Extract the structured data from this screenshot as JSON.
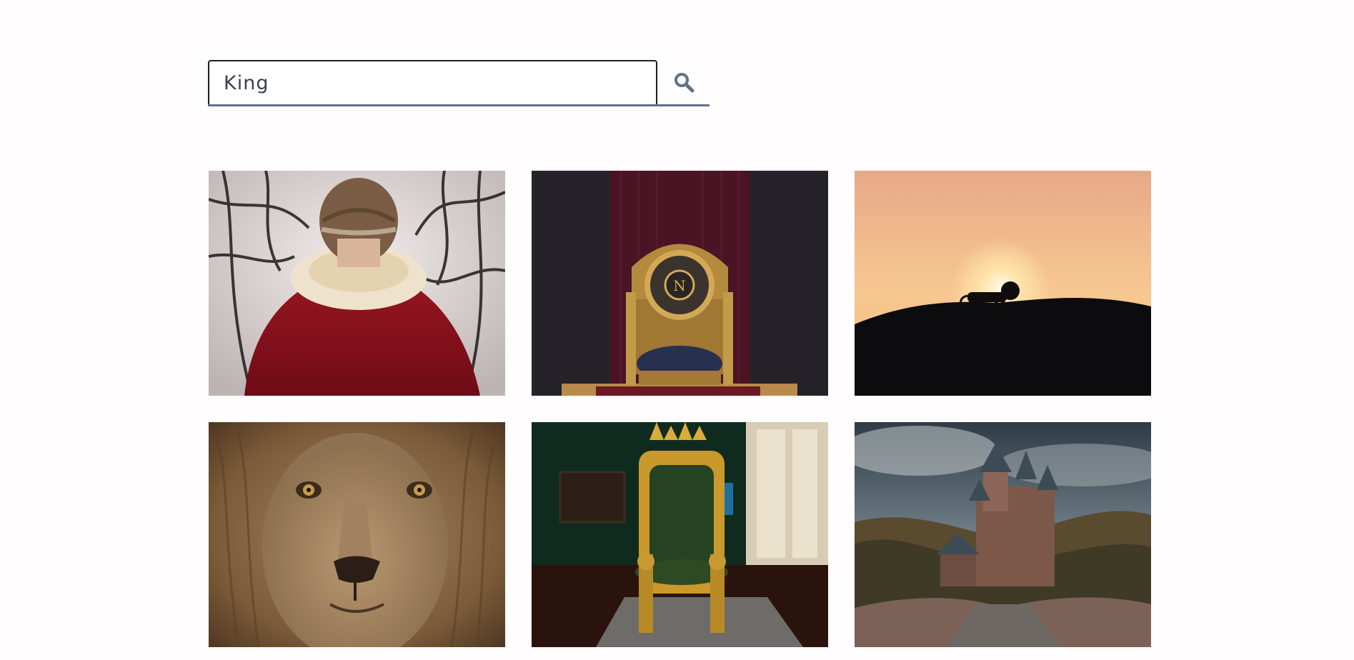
{
  "search": {
    "value": "King",
    "button_icon": "search-icon",
    "accent_color": "#5e7189"
  },
  "results": [
    {
      "subject": "person-in-red-royal-cape-with-fur-collar-and-crown"
    },
    {
      "subject": "golden-throne-with-n-emblem-in-front-of-red-curtain"
    },
    {
      "subject": "lion-silhouette-on-hill-at-sunset"
    },
    {
      "subject": "close-up-lion-face-with-mane"
    },
    {
      "subject": "gilded-throne-with-green-velvet-in-museum-room"
    },
    {
      "subject": "medieval-castle-on-hill-under-cloudy-sky"
    }
  ]
}
